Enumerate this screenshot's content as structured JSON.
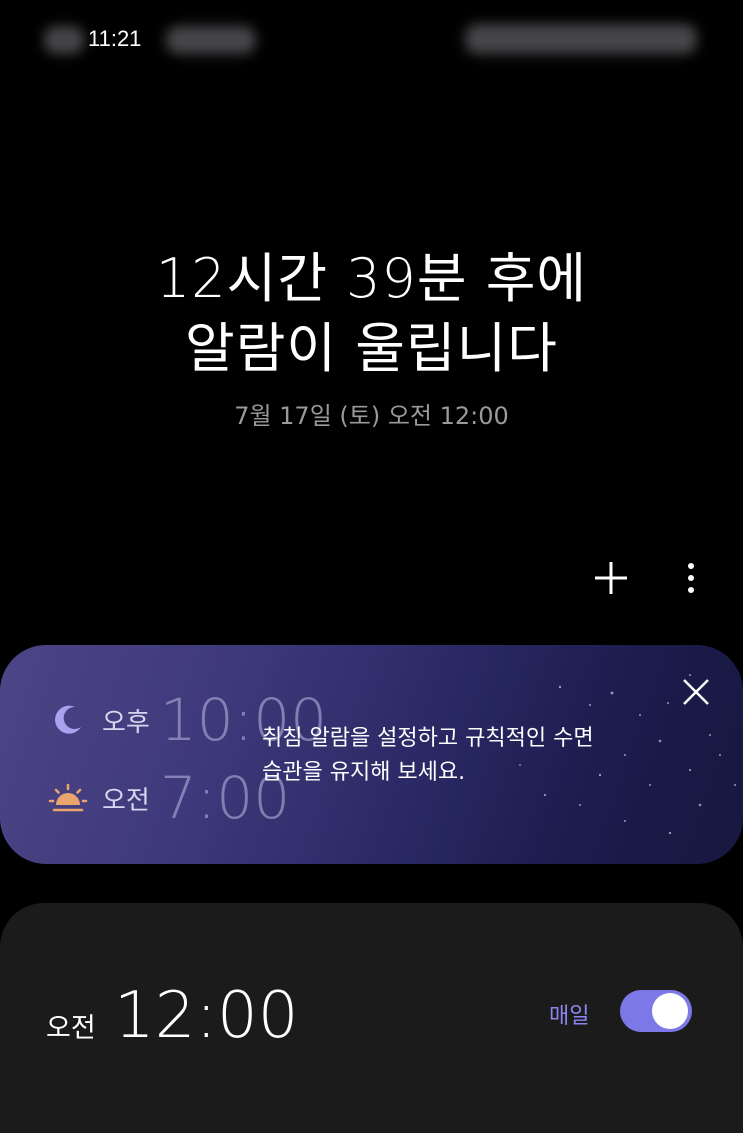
{
  "status_bar": {
    "time": "11:21"
  },
  "header": {
    "line1": "12시간 39분 후에",
    "line2": "알람이 울립니다",
    "next_alarm_date": "7월 17일 (토) 오전 12:00"
  },
  "toolbar": {
    "add_icon": "plus-icon",
    "more_icon": "more-vertical-icon"
  },
  "bedtime_card": {
    "bedtime": {
      "ampm": "오후",
      "time": "10:00",
      "icon": "moon-icon"
    },
    "wakeup": {
      "ampm": "오전",
      "time": "7:00",
      "icon": "sunrise-icon"
    },
    "message_line1": "취침 알람을 설정하고 규칙적인 수면",
    "message_line2": "습관을 유지해 보세요.",
    "close_icon": "close-icon",
    "colors": {
      "gradient_start": "#4c4586",
      "gradient_end": "#17173f"
    }
  },
  "alarms": [
    {
      "ampm": "오전",
      "time": "12:00",
      "repeat": "매일",
      "enabled": true
    }
  ],
  "colors": {
    "accent": "#7d78e8",
    "background": "#000000",
    "card": "#1b1b1b"
  }
}
